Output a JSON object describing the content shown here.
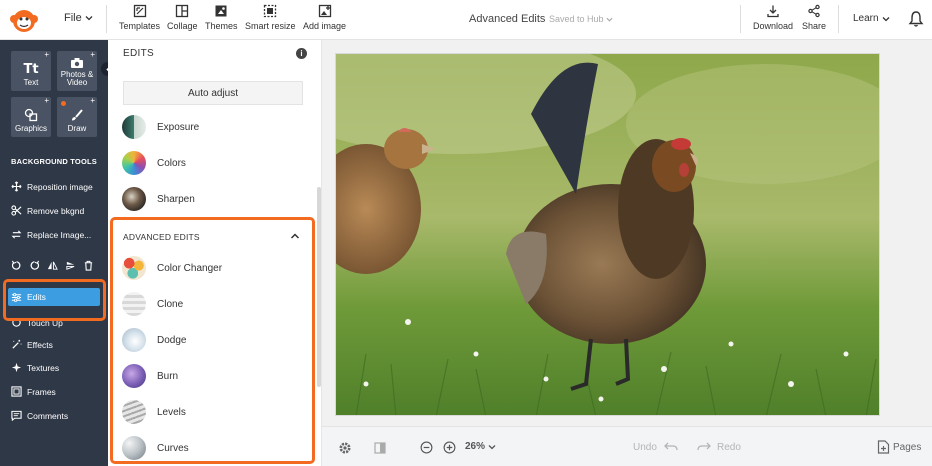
{
  "topbar": {
    "file_label": "File",
    "tools": [
      {
        "label": "Templates",
        "icon": "templates-icon"
      },
      {
        "label": "Collage",
        "icon": "collage-icon"
      },
      {
        "label": "Themes",
        "icon": "themes-icon"
      },
      {
        "label": "Smart resize",
        "icon": "smart-resize-icon"
      },
      {
        "label": "Add image",
        "icon": "add-image-icon"
      }
    ],
    "document_title": "Advanced Edits",
    "save_status": "Saved to Hub",
    "download_label": "Download",
    "share_label": "Share",
    "learn_label": "Learn"
  },
  "sidebar": {
    "tiles": [
      {
        "label": "Text",
        "glyph": "Tt"
      },
      {
        "label": "Photos & Video"
      },
      {
        "label": "Graphics"
      },
      {
        "label": "Draw"
      }
    ],
    "section_label": "BACKGROUND TOOLS",
    "background_tools": [
      "Reposition image",
      "Remove bkgnd",
      "Replace Image..."
    ],
    "active_item": "Edits",
    "partially_hidden_item": "Touch Up",
    "items": [
      "Effects",
      "Textures",
      "Frames",
      "Comments"
    ]
  },
  "panel": {
    "title": "EDITS",
    "auto_adjust_label": "Auto adjust",
    "basic_edits": [
      "Exposure",
      "Colors",
      "Sharpen"
    ],
    "advanced_title": "ADVANCED EDITS",
    "advanced_edits": [
      "Color Changer",
      "Clone",
      "Dodge",
      "Burn",
      "Levels",
      "Curves"
    ]
  },
  "bottombar": {
    "zoom": "26%",
    "undo_label": "Undo",
    "redo_label": "Redo",
    "pages_label": "Pages"
  },
  "colors": {
    "accent_orange": "#f36b21",
    "active_blue": "#3c9de0",
    "sidebar_bg": "#2f3847"
  }
}
